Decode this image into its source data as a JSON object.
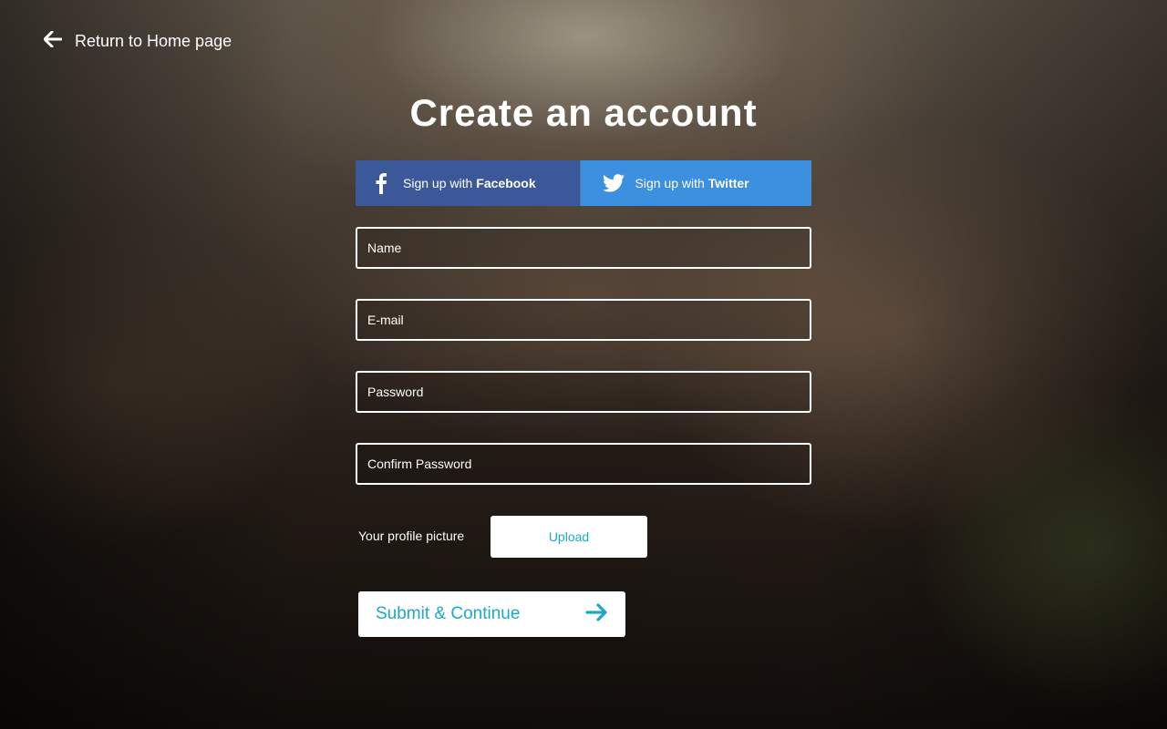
{
  "nav": {
    "return_label": "Return to Home page",
    "return_icon": "arrow-left-icon"
  },
  "title": "Create an account",
  "social": {
    "facebook": {
      "prefix": "Sign up with",
      "brand": "Facebook",
      "icon": "facebook-icon",
      "color": "#3b5998"
    },
    "twitter": {
      "prefix": "Sign up with",
      "brand": "Twitter",
      "icon": "twitter-icon",
      "color": "#3d8fe0"
    }
  },
  "form": {
    "name_placeholder": "Name",
    "email_placeholder": "E-mail",
    "password_placeholder": "Password",
    "confirm_password_placeholder": "Confirm Password",
    "profile_picture_label": "Your profile picture",
    "upload_label": "Upload",
    "submit_label": "Submit & Continue",
    "submit_icon": "arrow-right-icon"
  },
  "colors": {
    "accent": "#1ca9c9"
  }
}
